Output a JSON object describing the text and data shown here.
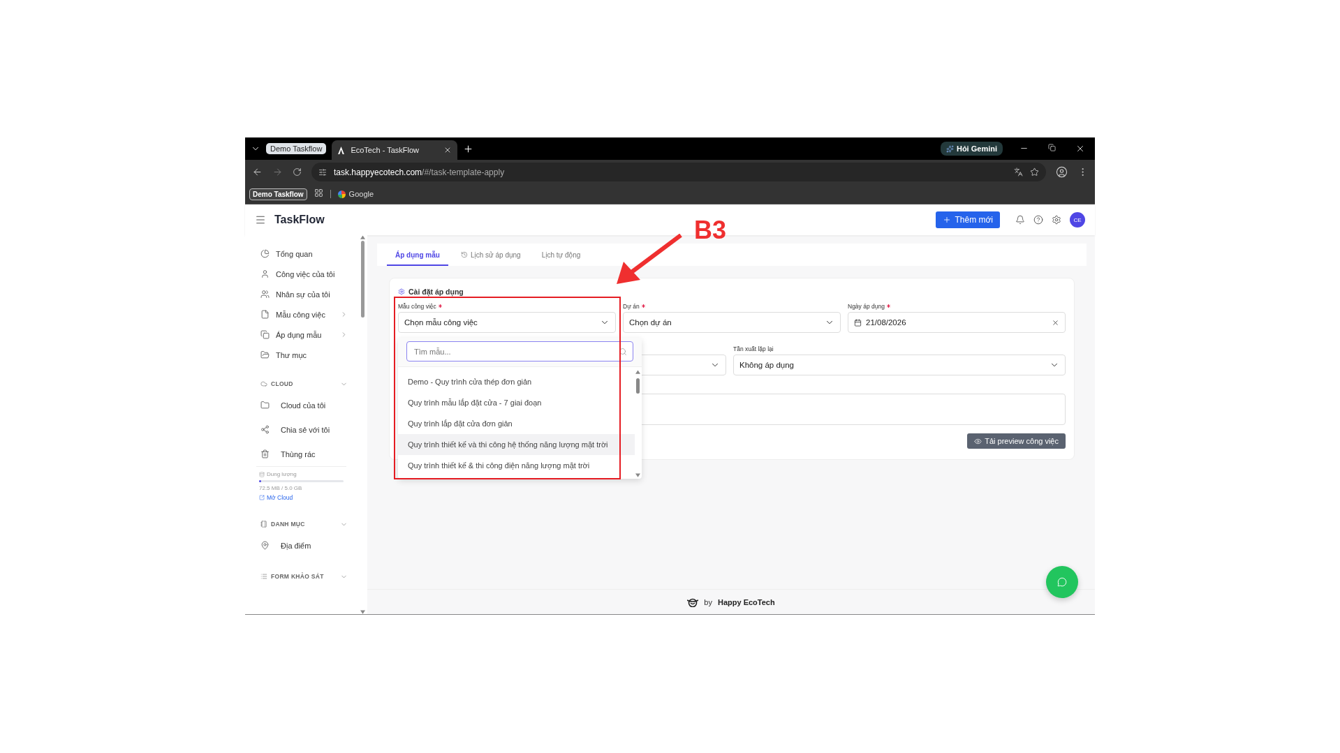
{
  "browser": {
    "tab_group": "Demo Taskflow",
    "tab_title": "EcoTech - TaskFlow",
    "gemini_button": "Hỏi Gemini",
    "url_host": "task.happyecotech.com",
    "url_path": "/#/task-template-apply",
    "bookmarks": [
      {
        "kind": "group",
        "label": "Demo Taskflow"
      },
      {
        "kind": "apps"
      },
      {
        "kind": "site",
        "label": "Google"
      }
    ]
  },
  "header": {
    "brand": "TaskFlow",
    "add_button": "Thêm mới",
    "avatar": "CE"
  },
  "sidebar": {
    "main": [
      {
        "label": "Tổng quan",
        "has_submenu": false
      },
      {
        "label": "Công việc của tôi",
        "has_submenu": false
      },
      {
        "label": "Nhân sự của tôi",
        "has_submenu": false
      },
      {
        "label": "Mẫu công việc",
        "has_submenu": true
      },
      {
        "label": "Áp dụng mẫu",
        "has_submenu": true
      },
      {
        "label": "Thư mục",
        "has_submenu": false
      }
    ],
    "sections": [
      {
        "title": "CLOUD",
        "expanded": true,
        "items": [
          {
            "label": "Cloud của tôi"
          },
          {
            "label": "Chia sẻ với tôi"
          },
          {
            "label": "Thùng rác"
          }
        ],
        "storage": {
          "label": "Dung lượng",
          "level": 0.015,
          "usage": "72.5 MB / 5.0 GB",
          "link": "Mở Cloud"
        }
      },
      {
        "title": "DANH MỤC",
        "expanded": true,
        "items": [
          {
            "label": "Địa điểm"
          }
        ]
      },
      {
        "title": "FORM KHẢO SÁT",
        "expanded": true
      }
    ]
  },
  "tabs": [
    {
      "label": "Áp dụng mẫu",
      "selected": true
    },
    {
      "label": "Lịch sử áp dụng",
      "selected": false
    },
    {
      "label": "Lịch tự động",
      "selected": false
    }
  ],
  "card": {
    "title": "Cài đặt áp dụng",
    "row_1": [
      {
        "kind": "select",
        "label": "Mẫu công việc",
        "required": true,
        "value": "Chọn mẫu công việc",
        "open": true
      },
      {
        "kind": "select",
        "label": "Dự án",
        "required": true,
        "value": "Chọn dự án"
      },
      {
        "kind": "date",
        "label": "Ngày áp dụng",
        "required": true,
        "value": "21/08/2026"
      }
    ],
    "row_2": [
      {
        "kind": "select"
      },
      {
        "kind": "select",
        "label": "Tần xuất lặp lại",
        "required": false,
        "value": "Không áp dụng"
      }
    ],
    "dropdown": {
      "placeholder": "Tìm mẫu...",
      "options": [
        {
          "label": "Demo - Quy trình cửa thép đơn giản",
          "highlighted": false
        },
        {
          "label": "Quy trình mẫu lắp đặt cửa - 7 giai đoạn",
          "highlighted": false
        },
        {
          "label": "Quy trình lắp đặt cửa đơn giản",
          "highlighted": false
        },
        {
          "label": "Quy trình thiết kế và thi công hệ thống năng lượng mặt trời",
          "highlighted": true
        },
        {
          "label": "Quy trình thiết kế & thi công điện năng lượng mặt trời",
          "highlighted": false
        }
      ]
    },
    "preview_button": "Tải preview công việc"
  },
  "footer": {
    "by": "by",
    "company": "Happy EcoTech"
  },
  "annotation": {
    "label": "B3"
  }
}
